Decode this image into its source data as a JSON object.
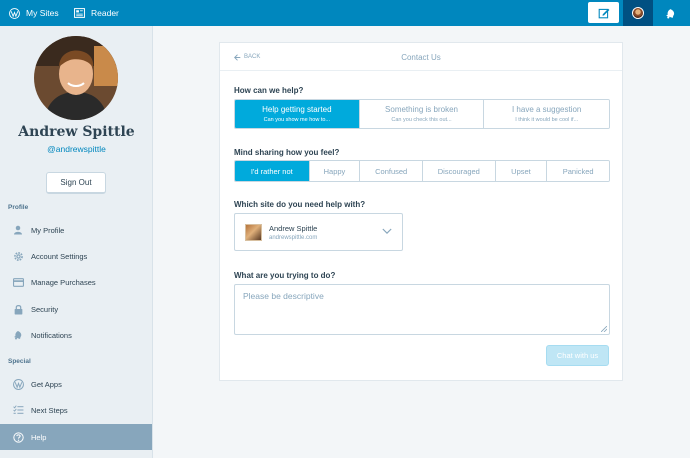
{
  "masterbar": {
    "my_sites": "My Sites",
    "reader": "Reader"
  },
  "profile": {
    "name": "Andrew Spittle",
    "handle": "@andrewspittle",
    "sign_out": "Sign Out"
  },
  "sidebar": {
    "profile_heading": "Profile",
    "special_heading": "Special",
    "items": [
      {
        "label": "My Profile",
        "icon": "user-icon"
      },
      {
        "label": "Account Settings",
        "icon": "cog-icon"
      },
      {
        "label": "Manage Purchases",
        "icon": "credit-card-icon"
      },
      {
        "label": "Security",
        "icon": "lock-icon"
      },
      {
        "label": "Notifications",
        "icon": "bell-icon"
      },
      {
        "label": "Get Apps",
        "icon": "wordpress-icon"
      },
      {
        "label": "Next Steps",
        "icon": "checklist-icon"
      },
      {
        "label": "Help",
        "icon": "help-icon",
        "selected": true
      }
    ]
  },
  "contact": {
    "back": "BACK",
    "title": "Contact Us",
    "q_help": "How can we help?",
    "help_options": [
      {
        "title": "Help getting started",
        "sub": "Can you show me how to...",
        "active": true
      },
      {
        "title": "Something is broken",
        "sub": "Can you check this out...",
        "active": false
      },
      {
        "title": "I have a suggestion",
        "sub": "I think it would be cool if...",
        "active": false
      }
    ],
    "q_feel": "Mind sharing how you feel?",
    "feel_options": [
      "I'd rather not",
      "Happy",
      "Confused",
      "Discouraged",
      "Upset",
      "Panicked"
    ],
    "feel_selected": "I'd rather not",
    "q_site": "Which site do you need help with?",
    "site_name": "Andrew Spittle",
    "site_url": "andrewspittle.com",
    "q_trying": "What are you trying to do?",
    "placeholder": "Please be descriptive",
    "chat_button": "Chat with us"
  },
  "colors": {
    "masterbar": "#0087be",
    "accent": "#00aadc",
    "sidebar_bg": "#e9eff3",
    "selected_item": "#87a6bc"
  }
}
